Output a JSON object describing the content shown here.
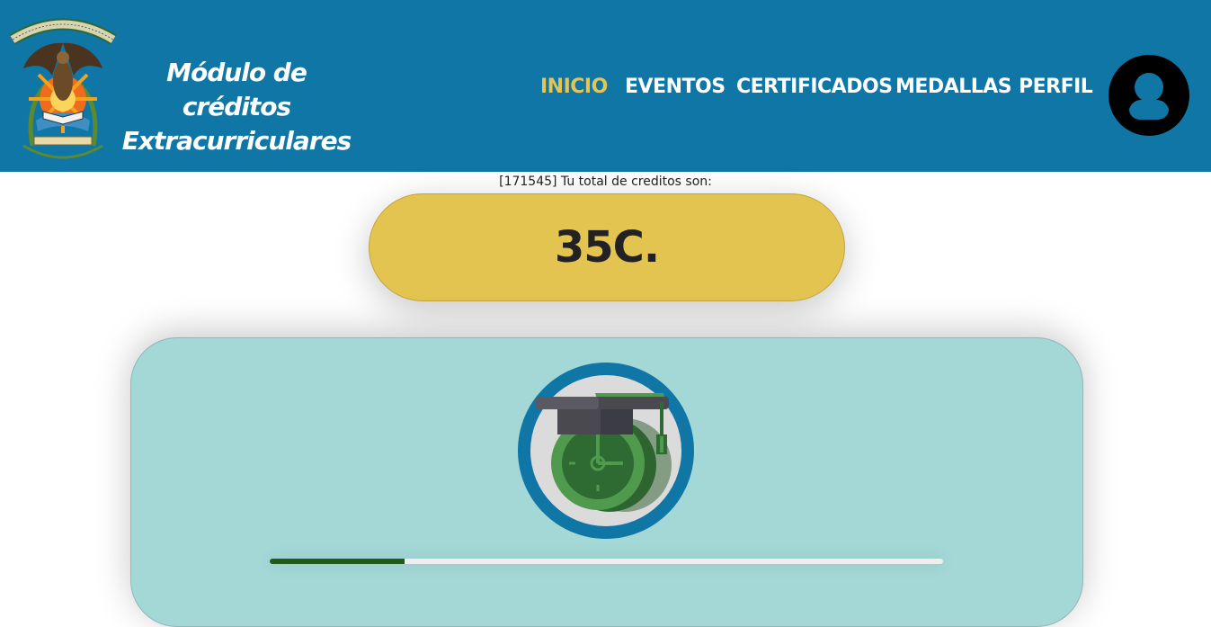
{
  "header": {
    "logo_text": "UNIVERSIDAD AUTONOMA DE SINALOA",
    "logo_motto": "SURSUM VERSUS",
    "title_line1": "Módulo de créditos",
    "title_line2": "Extracurriculares",
    "background_color": "#0f76a6"
  },
  "nav": {
    "items": [
      {
        "label": "INICIO",
        "active": true
      },
      {
        "label": "EVENTOS",
        "active": false
      },
      {
        "label": "CERTIFICADOS",
        "active": false
      },
      {
        "label": "MEDALLAS",
        "active": false
      },
      {
        "label": "PERFIL",
        "active": false
      }
    ],
    "active_color": "#e5c355",
    "avatar_icon": "user-circle-icon"
  },
  "credits": {
    "label": "[171545] Tu total de creditos son:",
    "value": "35C.",
    "pill_color": "#e3c450"
  },
  "card": {
    "background_color": "#a3d8d6",
    "badge_icon": "graduation-cap-clock-icon",
    "progress_fraction": 0.2,
    "progress_color": "#215b1c"
  }
}
